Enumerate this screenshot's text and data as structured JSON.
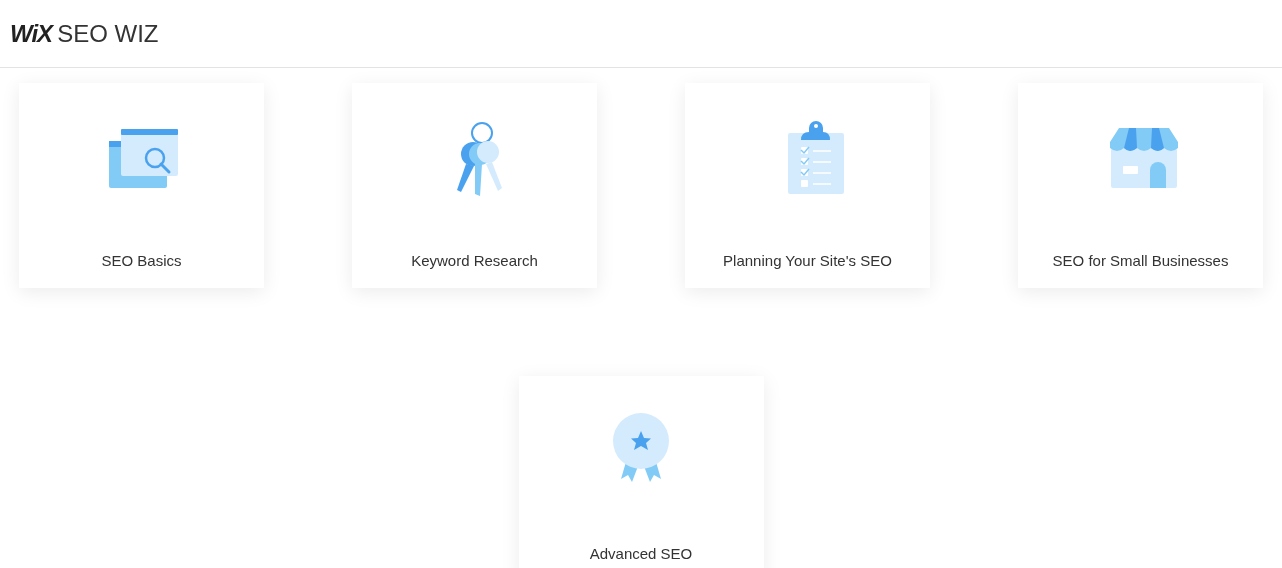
{
  "header": {
    "logo": "WiX",
    "title": "SEO WIZ"
  },
  "cards": [
    {
      "kind": "browser",
      "label": "SEO Basics"
    },
    {
      "kind": "keys",
      "label": "Keyword Research"
    },
    {
      "kind": "clipboard",
      "label": "Planning Your Site's SEO"
    },
    {
      "kind": "store",
      "label": "SEO for Small Businesses"
    },
    {
      "kind": "badge",
      "label": "Advanced SEO"
    }
  ]
}
